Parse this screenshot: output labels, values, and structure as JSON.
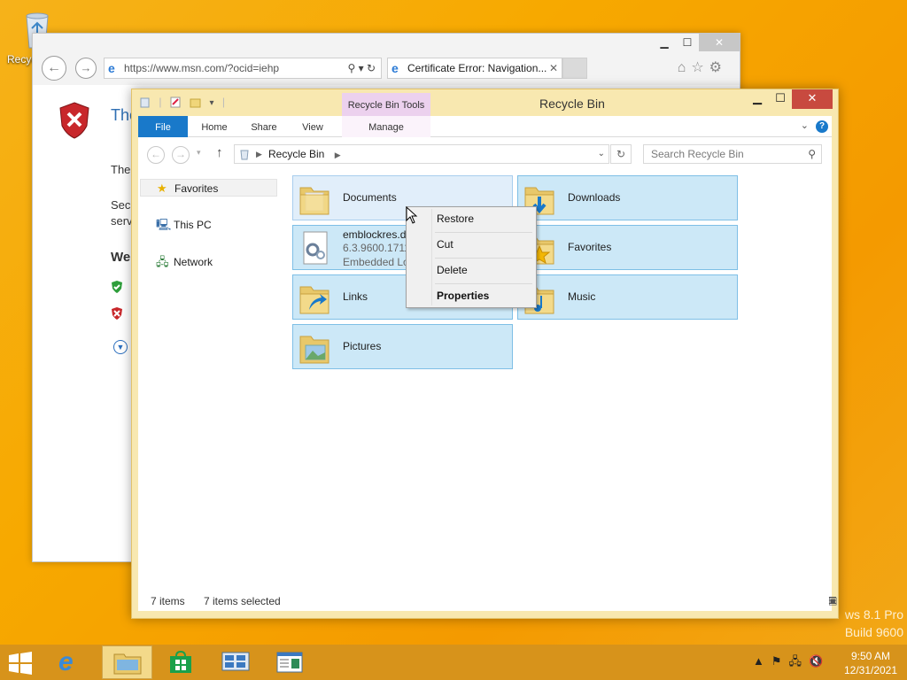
{
  "desktop": {
    "recycle_bin_label": "Recyc"
  },
  "watermark": {
    "line1": "ws 8.1 Pro",
    "line2": "Build 9600"
  },
  "ie": {
    "address": "https://www.msn.com/?ocid=iehp",
    "tab_title": "Certificate Error: Navigation...",
    "content": {
      "heading": "The",
      "para1": "The",
      "para2a": "Secu",
      "para2b": "serv",
      "subheading": "We"
    }
  },
  "explorer": {
    "title": "Recycle Bin",
    "tools_header": "Recycle Bin Tools",
    "ribbon_tabs": [
      "File",
      "Home",
      "Share",
      "View",
      "Manage"
    ],
    "breadcrumb": "Recycle Bin",
    "search_placeholder": "Search Recycle Bin",
    "nav": [
      "Favorites",
      "This PC",
      "Network"
    ],
    "items": [
      {
        "name": "Documents"
      },
      {
        "name": "Downloads"
      },
      {
        "name": "emblockres.d",
        "line2": "6.3.9600.1711(",
        "line3": "Embedded Lo"
      },
      {
        "name": "Favorites"
      },
      {
        "name": "Links"
      },
      {
        "name": "Music"
      },
      {
        "name": "Pictures"
      }
    ],
    "status": {
      "count": "7 items",
      "selected": "7 items selected"
    }
  },
  "context_menu": [
    "Restore",
    "Cut",
    "Delete",
    "Properties"
  ],
  "taskbar": {
    "time": "9:50 AM",
    "date": "12/31/2021"
  },
  "colors": {
    "explorer_frame": "#f8e8b0",
    "selection": "#cce8f7",
    "accent": "#1979ca",
    "taskbar": "#d7931b"
  }
}
